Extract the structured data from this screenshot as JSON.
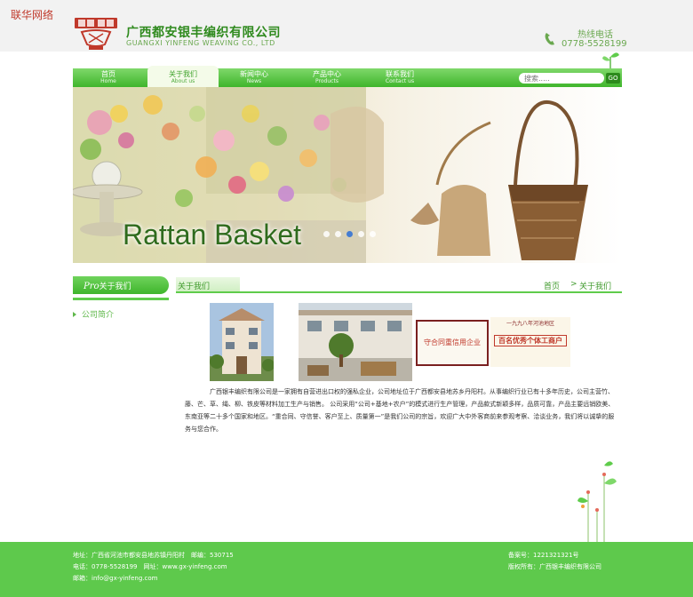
{
  "site_tag": "联华网络",
  "logo": {
    "cn_name": "广西都安银丰编织有限公司",
    "en_name": "GUANGXI YINFENG WEAVING CO., LTD"
  },
  "hotline": {
    "label": "热线电话",
    "number": "0778-5528199"
  },
  "nav": {
    "items": [
      {
        "cn": "首页",
        "en": "Home",
        "active": false
      },
      {
        "cn": "关于我们",
        "en": "About us",
        "active": true
      },
      {
        "cn": "新闻中心",
        "en": "News",
        "active": false
      },
      {
        "cn": "产品中心",
        "en": "Products",
        "active": false
      },
      {
        "cn": "联系我们",
        "en": "Contact us",
        "active": false
      }
    ],
    "search_placeholder": "搜索.....",
    "search_button": "GO"
  },
  "banner": {
    "title": "Rattan Basket",
    "slide_count": 5,
    "active_slide": 3
  },
  "sidebar": {
    "script": "Pro",
    "title": "关于我们",
    "items": [
      {
        "label": "公司简介"
      }
    ]
  },
  "main": {
    "heading": "关于我们",
    "breadcrumb": {
      "home": "首页",
      "separator": ">",
      "current": "关于我们"
    },
    "cert_plaque": "守合同重信用企业",
    "cert_sign_top": "一九九八年河池地区",
    "cert_sign_main": "百名优秀个体工商户",
    "paragraph": "广西银丰编织有限公司是一家拥有自营进出口权的强私企业，公司地址位于广西都安县地苏乡丹阳村。从事编织行业已有十多年历史，公司主营竹、藤、芒、草、绳、柳、铁皮等材料加工生产与销售。 公司采用“公司+基地+农户”的模式进行生产管理，产品款式新颖多样，品质可靠，产品主要远销欧美、东南亚等二十多个国家和地区。“重合同、守信誉、客户至上、质量第一”是我们公司的宗旨，欢迎广大中外客商前来参观考察、洽谈业务，我们将以诚挚的服务与您合作。"
  },
  "footer": {
    "address": "地址：广西省河池市都安县地苏镇丹阳村　邮编：530715",
    "phone": "电话：0778-5528199　网址：www.gx-yinfeng.com",
    "email": "邮箱：info@gx-yinfeng.com",
    "icp": "备案号：1221321321号",
    "copyright": "版权所有：广西银丰编织有限公司"
  },
  "colors": {
    "brand_green": "#3fb52c",
    "footer_green": "#5ec94c",
    "active_dot": "#2b6fd6"
  }
}
